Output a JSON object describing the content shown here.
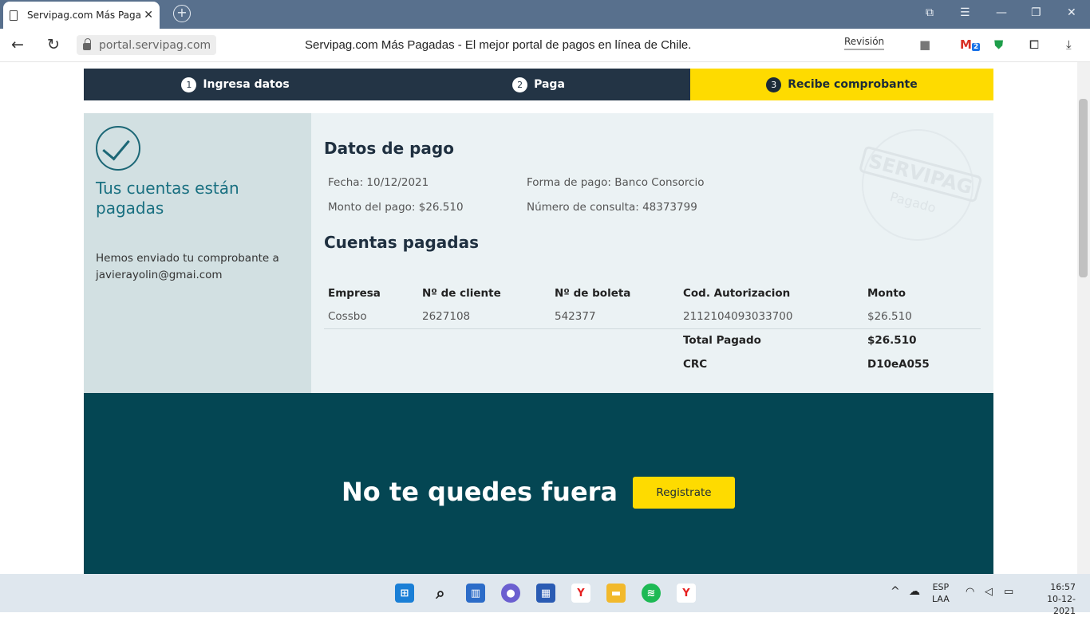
{
  "browser": {
    "tab_title": "Servipag.com Más Pagadas",
    "tab_close": "✕",
    "new_tab": "+",
    "url": "portal.servipag.com",
    "page_title": "Servipag.com Más Pagadas - El mejor portal de pagos en línea de Chile.",
    "revision_label": "Revisión",
    "gmail_badge": "2"
  },
  "steps": [
    {
      "num": "1",
      "label": "Ingresa datos"
    },
    {
      "num": "2",
      "label": "Paga"
    },
    {
      "num": "3",
      "label": "Recibe comprobante"
    }
  ],
  "left": {
    "title": "Tus cuentas están pagadas",
    "message": "Hemos enviado tu comprobante a javierayolin@gmai.com"
  },
  "payment": {
    "title": "Datos de pago",
    "fecha": "Fecha: 10/12/2021",
    "monto": "Monto del pago: $26.510",
    "forma": "Forma de pago: Banco Consorcio",
    "consulta": "Número de consulta: 48373799",
    "stamp_brand": "SERVIPAG",
    "stamp_status": "Pagado"
  },
  "accounts": {
    "title": "Cuentas pagadas",
    "headers": [
      "Empresa",
      "Nº de cliente",
      "Nº de boleta",
      "Cod. Autorizacion",
      "Monto"
    ],
    "row": [
      "Cossbo",
      "2627108",
      "542377",
      "2112104093033700",
      "$26.510"
    ],
    "total_label": "Total Pagado",
    "total_value": "$26.510",
    "crc_label": "CRC",
    "crc_value": "D10eA055"
  },
  "banner": {
    "text": "No te quedes fuera",
    "button": "Registrate"
  },
  "taskbar": {
    "lang": "ESP",
    "layout": "LAA",
    "time": "16:57",
    "date": "10-12-2021"
  },
  "colors": {
    "step_dark": "#233445",
    "step_active": "#fedb00",
    "banner": "#044653",
    "accent_teal": "#186f80"
  }
}
